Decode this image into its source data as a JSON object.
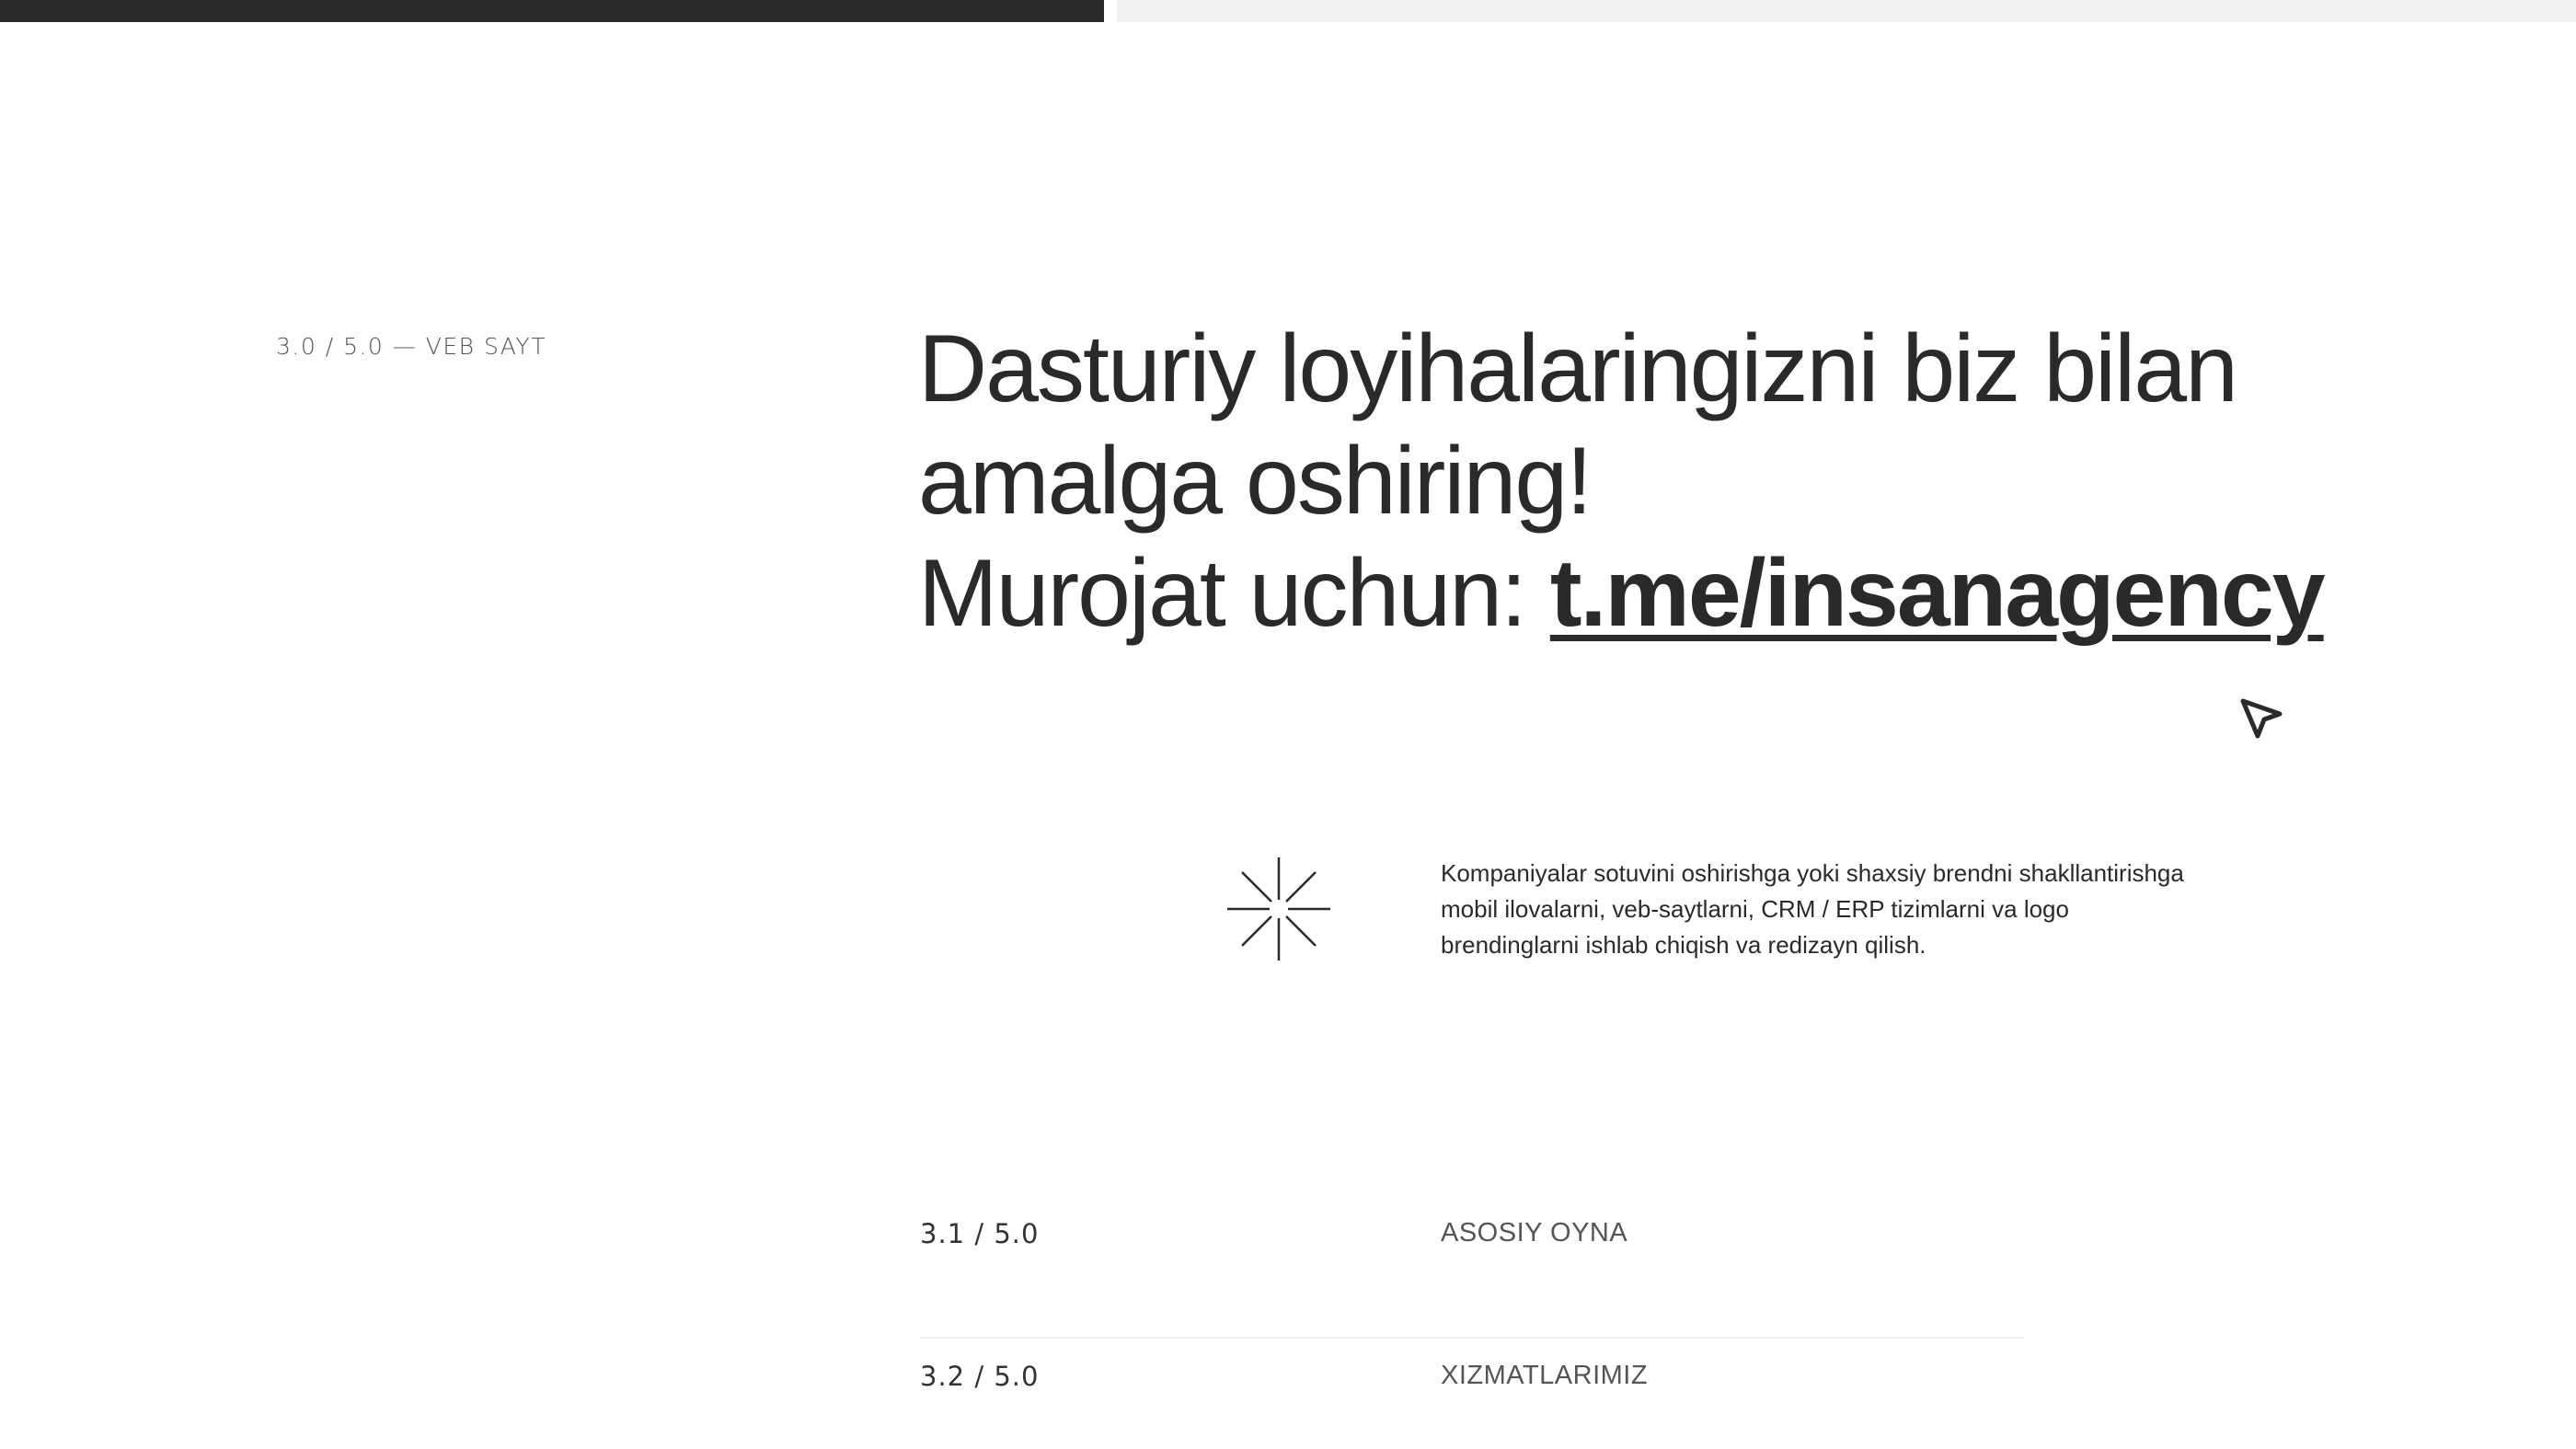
{
  "section": {
    "label": "3.0 / 5.0 — VEB SAYT"
  },
  "hero": {
    "line1": "Dasturiy loyihalaringizni biz bilan",
    "line2": "amalga oshiring!",
    "contact_prefix": "Murojat uchun: ",
    "contact_link": "t.me/insanagency"
  },
  "intro": {
    "description": "Kompaniyalar sotuvini oshirishga yoki shaxsiy brendni shakllantirishga mobil ilovalarni, veb-saytlarni, CRM / ERP tizimlarni va logo brendinglarni  ishlab chiqish va redizayn qilish."
  },
  "index": {
    "items": [
      {
        "number": "3.1 / 5.0",
        "title": "ASOSIY OYNA"
      },
      {
        "number": "3.2 / 5.0",
        "title": "XIZMATLARIMIZ"
      }
    ]
  },
  "icons": {
    "cursor": "cursor-arrow-icon",
    "star": "sparkle-star-icon"
  },
  "colors": {
    "text": "#2a2a2a",
    "top_bar_dark": "#2b2b2b",
    "top_bar_light": "#f1f1f3",
    "divider": "#efefef"
  }
}
